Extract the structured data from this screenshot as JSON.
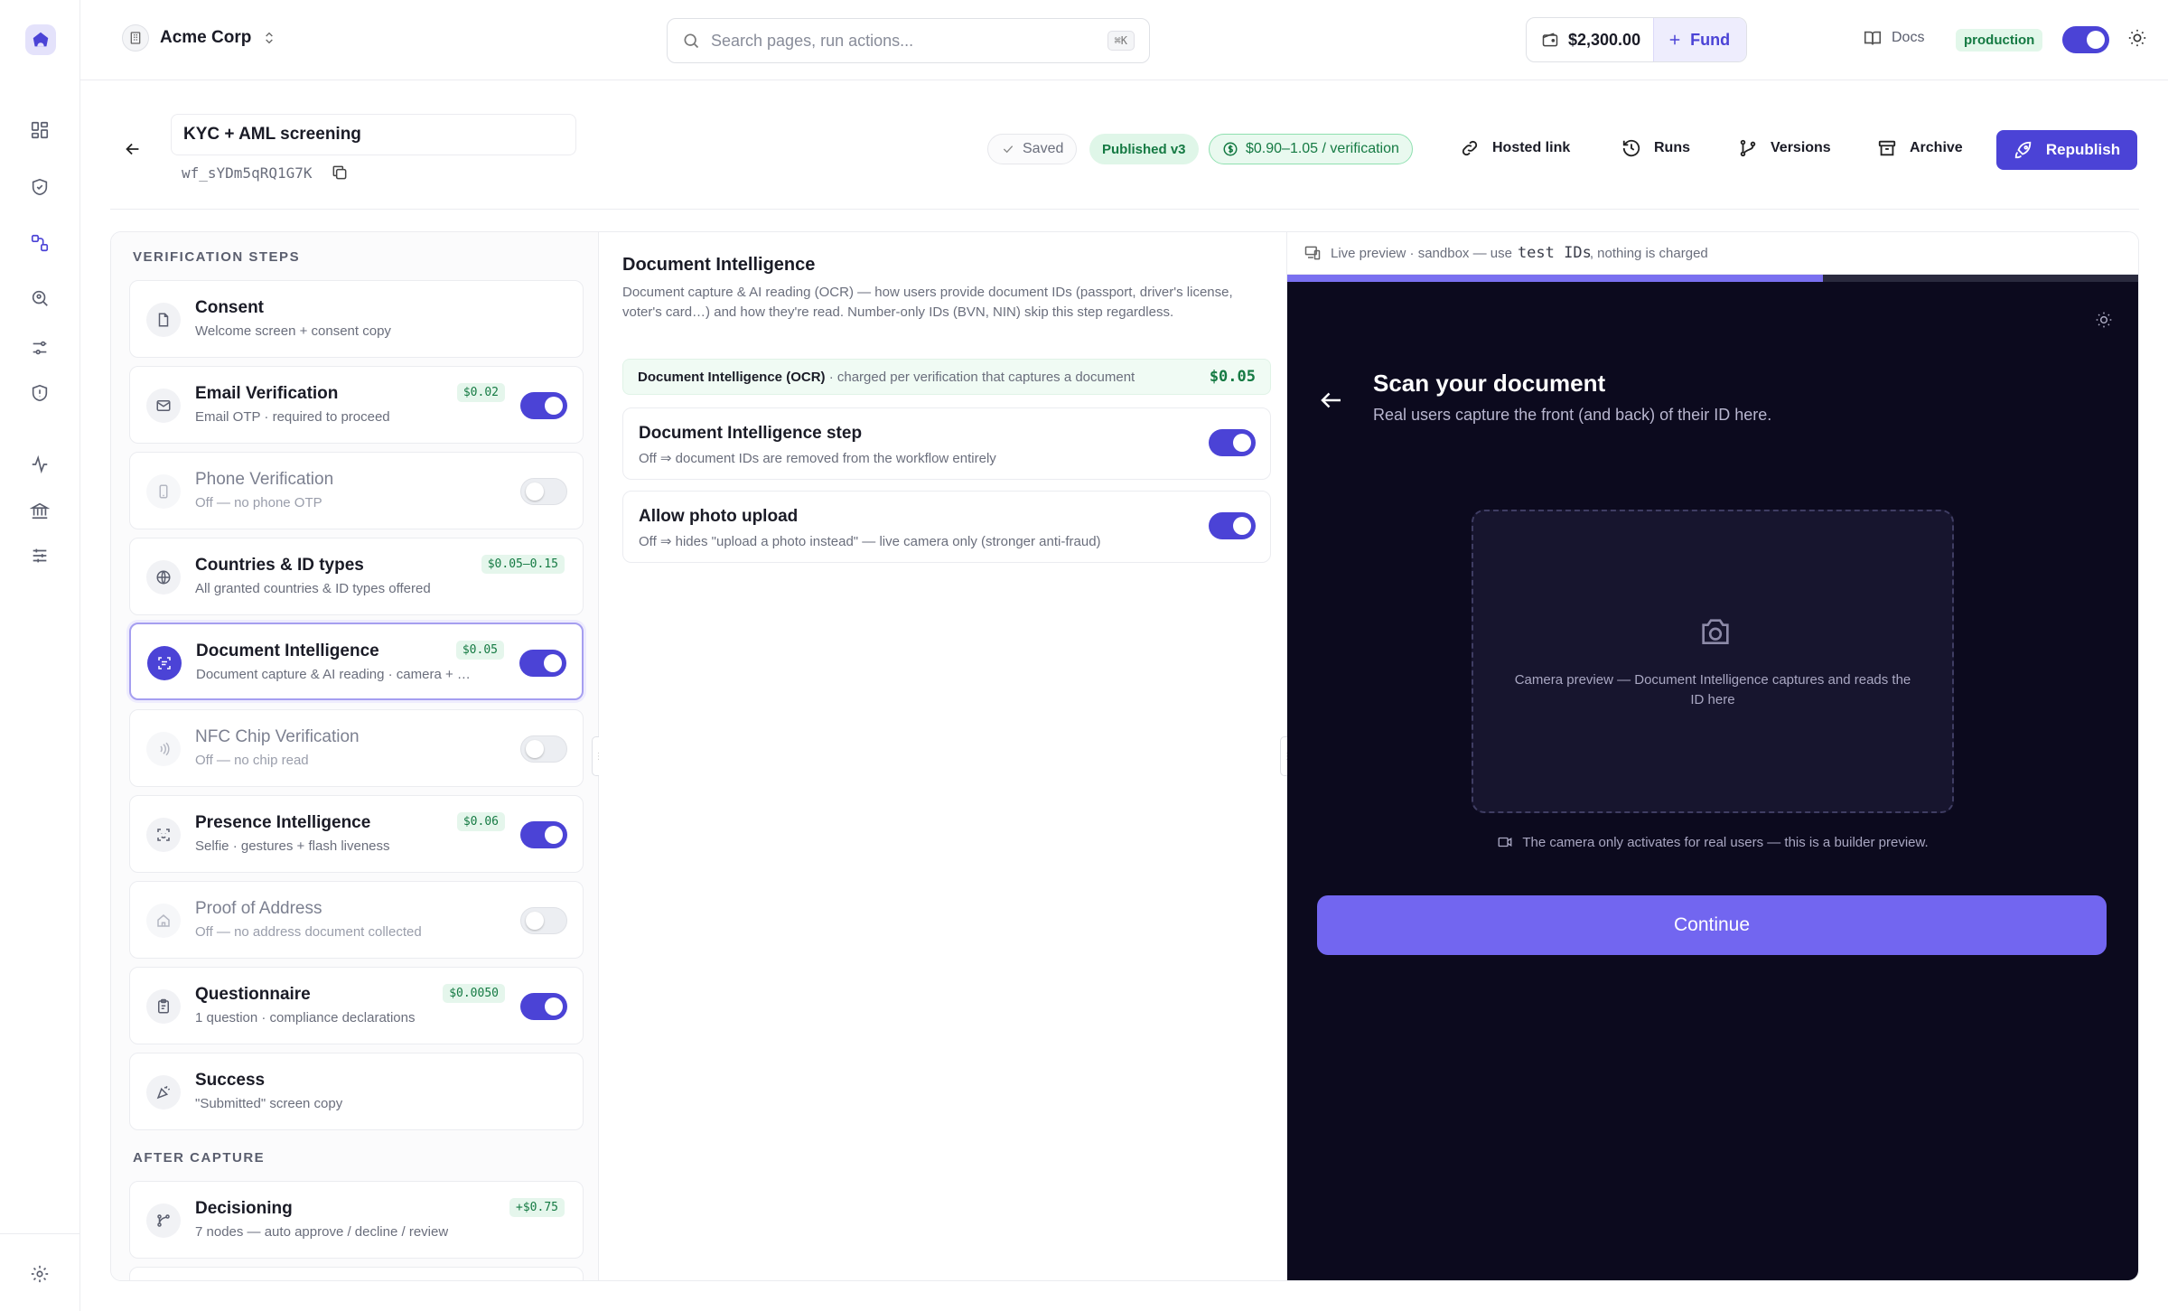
{
  "topbar": {
    "org_name": "Acme Corp",
    "search_placeholder": "Search pages, run actions...",
    "search_shortcut": "⌘K",
    "balance": "$2,300.00",
    "fund_label": "Fund",
    "docs_label": "Docs",
    "environment": "production"
  },
  "workflow": {
    "name": "KYC + AML screening",
    "id": "wf_sYDm5qRQ1G7K",
    "saved_label": "Saved",
    "published_label": "Published v3",
    "price_label": "$0.90–1.05 / verification",
    "actions": {
      "hosted_link": "Hosted link",
      "runs": "Runs",
      "versions": "Versions",
      "archive": "Archive",
      "republish": "Republish"
    }
  },
  "steps_panel": {
    "section_title": "VERIFICATION STEPS",
    "after_section_title": "AFTER CAPTURE",
    "steps": [
      {
        "title": "Consent",
        "subtitle": "Welcome screen + consent copy",
        "cost": "",
        "toggle": null,
        "icon": "document-icon"
      },
      {
        "title": "Email Verification",
        "subtitle": "Email OTP · required to proceed",
        "cost": "$0.02",
        "toggle": "on",
        "icon": "mail-icon"
      },
      {
        "title": "Phone Verification",
        "subtitle": "Off — no phone OTP",
        "cost": "",
        "toggle": "off",
        "icon": "phone-icon"
      },
      {
        "title": "Countries & ID types",
        "subtitle": "All granted countries & ID types offered",
        "cost": "$0.05–0.15",
        "toggle": null,
        "icon": "globe-icon"
      },
      {
        "title": "Document Intelligence",
        "subtitle": "Document capture & AI reading · camera + …",
        "cost": "$0.05",
        "toggle": "on",
        "icon": "scan-icon"
      },
      {
        "title": "NFC Chip Verification",
        "subtitle": "Off — no chip read",
        "cost": "",
        "toggle": "off",
        "icon": "nfc-icon"
      },
      {
        "title": "Presence Intelligence",
        "subtitle": "Selfie · gestures + flash liveness",
        "cost": "$0.06",
        "toggle": "on",
        "icon": "face-scan-icon"
      },
      {
        "title": "Proof of Address",
        "subtitle": "Off — no address document collected",
        "cost": "",
        "toggle": "off",
        "icon": "home-icon"
      },
      {
        "title": "Questionnaire",
        "subtitle": "1 question · compliance declarations",
        "cost": "$0.0050",
        "toggle": "on",
        "icon": "clipboard-icon"
      },
      {
        "title": "Success",
        "subtitle": "\"Submitted\" screen copy",
        "cost": "",
        "toggle": null,
        "icon": "party-icon"
      }
    ],
    "after_steps": [
      {
        "title": "Decisioning",
        "subtitle": "7 nodes — auto approve / decline / review",
        "cost": "+$0.75",
        "icon": "branch-icon"
      }
    ]
  },
  "detail": {
    "title": "Document Intelligence",
    "description": "Document capture & AI reading (OCR) — how users provide document IDs (passport, driver's license, voter's card…) and how they're read. Number-only IDs (BVN, NIN) skip this step regardless.",
    "charge_label": "Document Intelligence (OCR)",
    "charge_desc": " · charged per verification that captures a document",
    "charge_amount": "$0.05",
    "settings": [
      {
        "title": "Document Intelligence step",
        "subtitle": "Off ⇒ document IDs are removed from the workflow entirely",
        "toggle": "on"
      },
      {
        "title": "Allow photo upload",
        "subtitle": "Off ⇒ hides \"upload a photo instead\" — live camera only (stronger anti-fraud)",
        "toggle": "on"
      }
    ]
  },
  "preview": {
    "header_prefix": "Live preview · sandbox — use",
    "header_code": "test IDs",
    "header_suffix": ", nothing is charged",
    "progress": 0.63,
    "title": "Scan your document",
    "subtitle": "Real users capture the front (and back) of their ID here.",
    "camera_text": "Camera preview — Document Intelligence captures and reads the ID here",
    "note": "The camera only activates for real users — this is a builder preview.",
    "button_label": "Continue"
  },
  "colors": {
    "accent": "#4b43d6",
    "preview_bg": "#0c0a1e",
    "preview_button": "#7266f0",
    "success": "#157a43"
  }
}
